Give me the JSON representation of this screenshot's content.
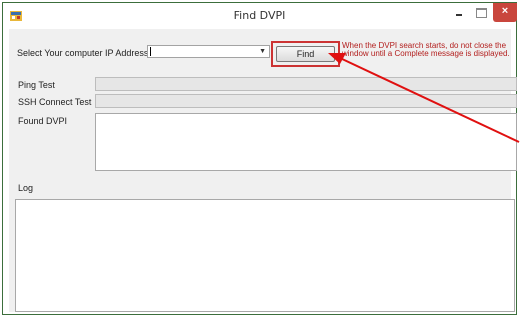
{
  "window": {
    "title": "Find DVPI",
    "app_icon": "app-icon",
    "close_label": "×"
  },
  "form": {
    "ip_label": "Select Your computer IP Address",
    "ip_value": "",
    "find_label": "Find",
    "notice_text": "When the DVPI search starts, do not close the window until a Complete  message is displayed.",
    "ping_label": "Ping Test",
    "ssh_label": "SSH Connect Test",
    "found_label": "Found DVPI",
    "log_label": "Log",
    "ping_progress": 0,
    "ssh_progress": 0
  },
  "colors": {
    "notice": "#b3201f",
    "highlight": "#cc3333",
    "arrow": "#e01010"
  }
}
